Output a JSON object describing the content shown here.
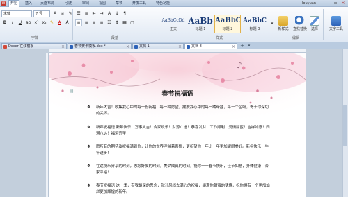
{
  "menu": {
    "app_badge": "W",
    "items": [
      "开始",
      "插入",
      "页面布局",
      "引用",
      "审阅",
      "视图",
      "章节",
      "开发工具",
      "特色功能"
    ],
    "active_index": 0,
    "user": "louyuan"
  },
  "ribbon": {
    "font_name": "宋体",
    "font_size": "五号",
    "groups": [
      "字体",
      "段落",
      "样式",
      "编辑"
    ],
    "styles": [
      {
        "sample": "AaBbCcDd",
        "name": "正文"
      },
      {
        "sample": "AaBb",
        "name": "标题 1"
      },
      {
        "sample": "AaBbC",
        "name": "标题 2"
      },
      {
        "sample": "AaBbC",
        "name": "标题 3"
      }
    ],
    "selected_style_index": 2,
    "new_style_label": "新样式",
    "find_replace_label": "查找替换",
    "select_label": "选择",
    "text_tools_label": "文字工具"
  },
  "tabs": [
    {
      "label": "Docer-在线模板",
      "color": "#d14a3a"
    },
    {
      "label": "春节贺卡模板.doc *",
      "color": "#2d62b8"
    },
    {
      "label": "文档 1",
      "color": "#2d62b8"
    },
    {
      "label": "文档 8",
      "color": "#2d62b8"
    }
  ],
  "active_tab_index": 3,
  "document": {
    "title": "春节祝福语",
    "paragraphs": [
      "新年大吉！收集我心中的每一份祝福，每一种愿望，摆脱我心中的每一缕牵挂，每一个企盼，寄于你深切的关怀。",
      "新年祝福语 新年快乐！万事大吉！合家欢乐！财源广进！恭喜发财！工作顺利！爱情甜蜜！吉祥如意！四通八达！福运齐至！",
      "愿所有的期待及祝福满到位，让你的世界洋溢着喜悦，更祈望你一年比一年更加耀眼美好。新年快乐，牛年进步！",
      "在这快乐分享的时刻，思念好友的时刻，美梦成真的时刻，祝你一一春节快乐，佳节如意，身体健康，合家幸福！",
      "春节祝福语 这一季，有我最深的思念，就让风捎去满心的祝福，缀满你甜蜜的梦境，祝你拥有一个更加灿烂更加辉煌的新年。"
    ]
  },
  "colors": {
    "accent": "#2d62b8",
    "ribbon_top": "#fbfcfe",
    "workspace": "#c3cfdc"
  }
}
